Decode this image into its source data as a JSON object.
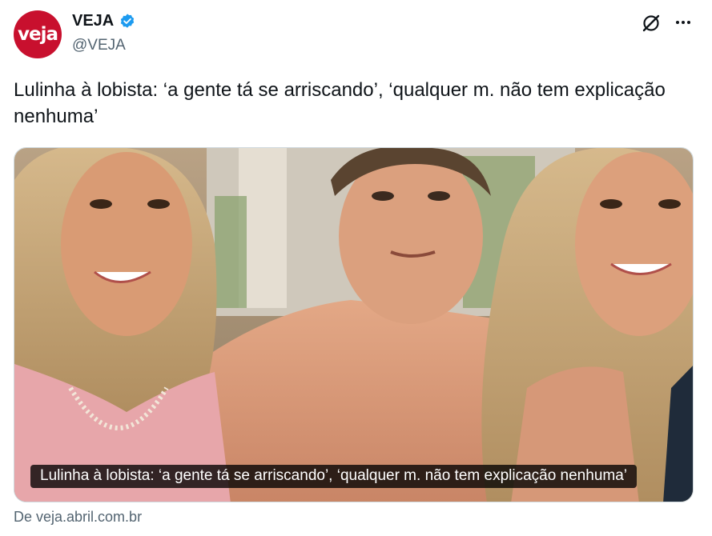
{
  "author": {
    "avatar_text": "veja",
    "display_name": "VEJA",
    "handle": "@VEJA",
    "verified": true
  },
  "header_icons": [
    "grok-icon",
    "more-icon"
  ],
  "tweet": {
    "text": "Lulinha à lobista: ‘a gente tá se arriscando’, ‘qualquer m. não tem explicação nenhuma’"
  },
  "card": {
    "caption": "Lulinha à lobista: ‘a gente tá se arriscando’, ‘qualquer m. não tem explicação nenhuma’",
    "source": "De veja.abril.com.br"
  },
  "colors": {
    "brand_red": "#c8102e",
    "verified_blue": "#1d9bf0",
    "secondary_text": "#536471"
  }
}
